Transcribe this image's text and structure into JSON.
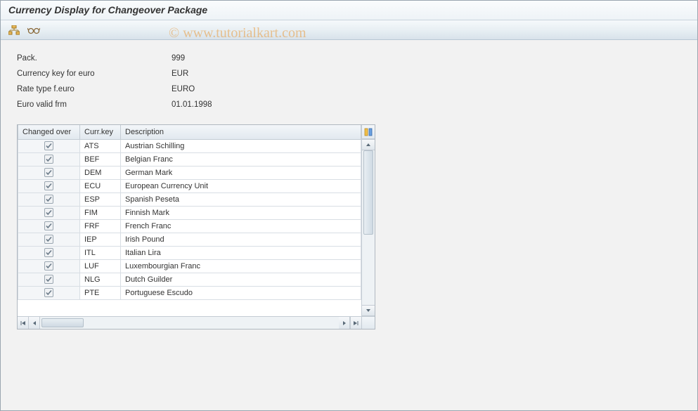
{
  "watermark": "© www.tutorialkart.com",
  "header": {
    "title": "Currency Display for Changeover Package"
  },
  "toolbar": {
    "icon1": "structure-icon",
    "icon2": "glasses-icon"
  },
  "fields": {
    "pack_label": "Pack.",
    "pack_value": "999",
    "currkey_label": "Currency key for euro",
    "currkey_value": "EUR",
    "ratetype_label": "Rate type f.euro",
    "ratetype_value": "EURO",
    "validfrom_label": "Euro valid frm",
    "validfrom_value": "01.01.1998"
  },
  "table": {
    "headers": {
      "changed": "Changed over",
      "key": "Curr.key",
      "desc": "Description"
    },
    "rows": [
      {
        "checked": true,
        "key": "ATS",
        "desc": "Austrian Schilling"
      },
      {
        "checked": true,
        "key": "BEF",
        "desc": "Belgian Franc"
      },
      {
        "checked": true,
        "key": "DEM",
        "desc": "German Mark"
      },
      {
        "checked": true,
        "key": "ECU",
        "desc": "European Currency Unit"
      },
      {
        "checked": true,
        "key": "ESP",
        "desc": "Spanish Peseta"
      },
      {
        "checked": true,
        "key": "FIM",
        "desc": "Finnish Mark"
      },
      {
        "checked": true,
        "key": "FRF",
        "desc": "French Franc"
      },
      {
        "checked": true,
        "key": "IEP",
        "desc": "Irish Pound"
      },
      {
        "checked": true,
        "key": "ITL",
        "desc": "Italian Lira"
      },
      {
        "checked": true,
        "key": "LUF",
        "desc": "Luxembourgian Franc"
      },
      {
        "checked": true,
        "key": "NLG",
        "desc": "Dutch Guilder"
      },
      {
        "checked": true,
        "key": "PTE",
        "desc": "Portuguese Escudo"
      }
    ]
  }
}
